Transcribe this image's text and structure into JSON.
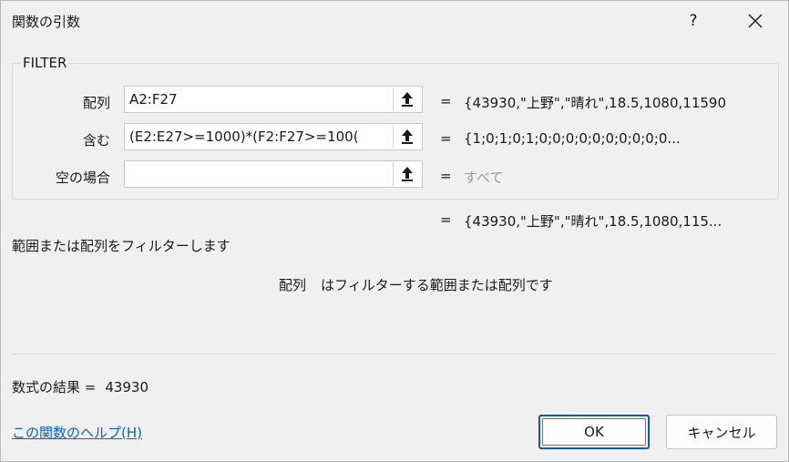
{
  "dialog": {
    "title": "関数の引数",
    "help_symbol": "?",
    "close_icon": "close-icon"
  },
  "function": {
    "name": "FILTER",
    "args": [
      {
        "label": "配列",
        "value": "A2:F27",
        "eq": "=",
        "result": "{43930,\"上野\",\"晴れ\",18.5,1080,11590"
      },
      {
        "label": "含む",
        "value": "(E2:E27>=1000)*(F2:F27>=100(",
        "eq": "=",
        "result": "{1;0;1;0;1;0;0;0;0;0;0;0;0;0;0..."
      },
      {
        "label": "空の場合",
        "value": "",
        "eq": "=",
        "result": "すべて"
      }
    ],
    "overall_eq": "=",
    "overall_result": "{43930,\"上野\",\"晴れ\",18.5,1080,115...",
    "description": "範囲または配列をフィルターします",
    "arg_desc_name": "配列",
    "arg_desc_text": "はフィルターする範囲または配列です"
  },
  "formula_result": {
    "label": "数式の結果 =",
    "value": "43930"
  },
  "footer": {
    "help_link": "この関数のヘルプ(H)",
    "ok_label": "OK",
    "cancel_label": "キャンセル"
  },
  "colors": {
    "link": "#0b62c4",
    "ok_border": "#0a5bb8",
    "muted_text": "#9a9a9a"
  }
}
